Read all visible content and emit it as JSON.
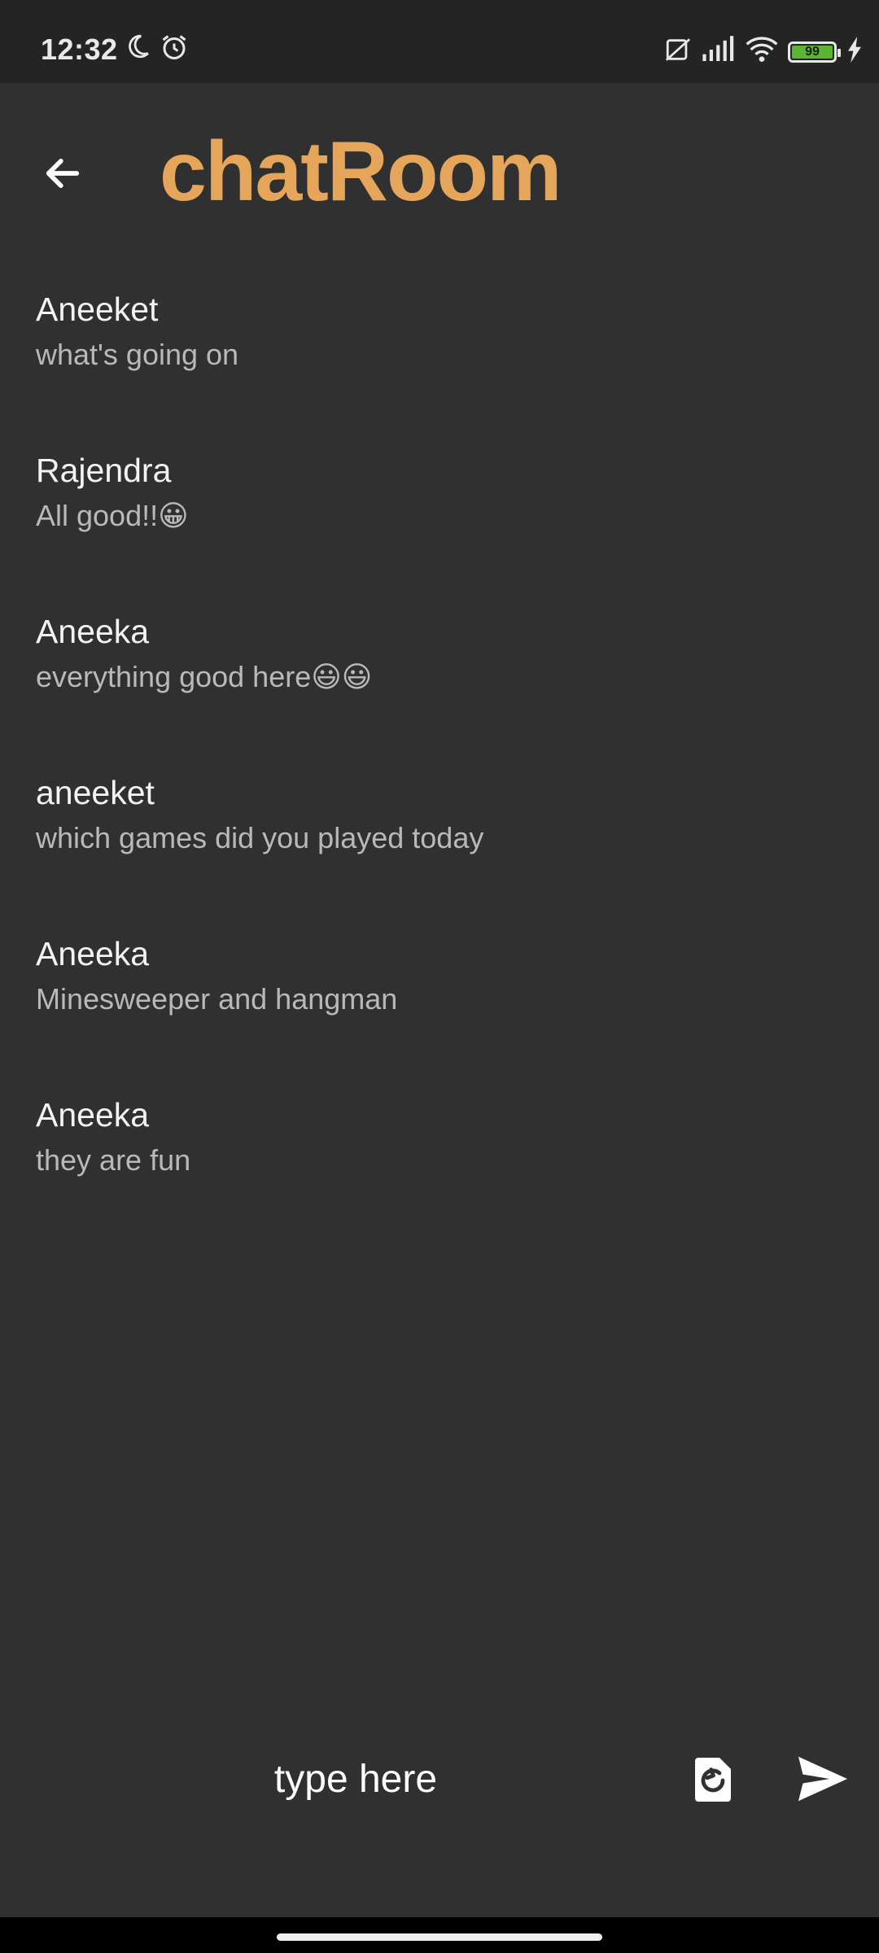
{
  "status_bar": {
    "time": "12:32",
    "battery_level": "99",
    "icons": [
      "moon-icon",
      "alarm-icon",
      "no-sim-icon",
      "signal-icon",
      "wifi-icon",
      "battery-icon",
      "charging-icon"
    ]
  },
  "header": {
    "title": "chatRoom",
    "back_icon": "arrow-left-icon"
  },
  "messages": [
    {
      "sender": "Aneeket",
      "text": "what's going on"
    },
    {
      "sender": "Rajendra",
      "text": "All good!!😀"
    },
    {
      "sender": "Aneeka",
      "text": "everything good here😃😃"
    },
    {
      "sender": "aneeket",
      "text": "which games did you played today"
    },
    {
      "sender": "Aneeka",
      "text": "Minesweeper and hangman"
    },
    {
      "sender": "Aneeka",
      "text": "they are fun"
    }
  ],
  "composer": {
    "placeholder": "type here",
    "value": "",
    "refresh_icon": "refresh-icon",
    "send_icon": "send-icon"
  },
  "colors": {
    "background": "#303030",
    "status_bar": "#242424",
    "accent": "#e5a55a",
    "battery_fill": "#5cb531"
  }
}
